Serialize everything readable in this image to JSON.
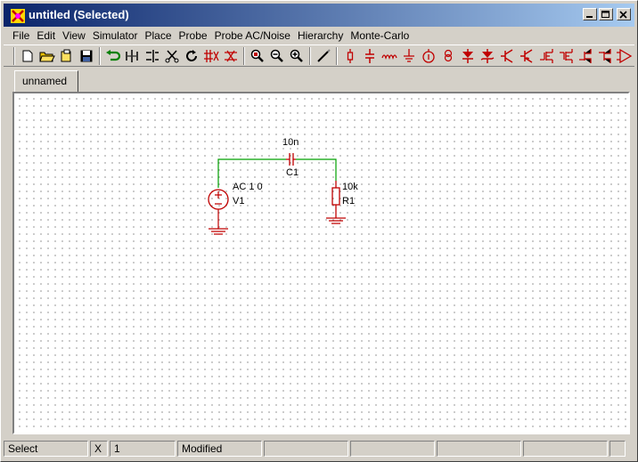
{
  "window": {
    "title": "untitled (Selected)"
  },
  "menu": [
    "File",
    "Edit",
    "View",
    "Simulator",
    "Place",
    "Probe",
    "Probe AC/Noise",
    "Hierarchy",
    "Monte-Carlo"
  ],
  "toolbar": {
    "groups": [
      [
        "new-icon",
        "open-folder-icon",
        "open-file-icon",
        "save-icon"
      ],
      [
        "undo-icon",
        "mirror-horizontal-icon",
        "mirror-vertical-icon",
        "cut-icon",
        "rotate-icon",
        "delete-wire-icon",
        "duplicate-icon"
      ],
      [
        "zoom-fit-icon",
        "zoom-out-icon",
        "zoom-in-icon"
      ],
      [
        "wire-draw-icon"
      ],
      [
        "resistor-icon",
        "capacitor-icon",
        "inductor-icon",
        "ground-icon",
        "voltage-source-icon",
        "current-source-icon",
        "diode-icon",
        "zener-icon",
        "npn-icon",
        "pnp-icon",
        "nmos-icon",
        "pmos-icon",
        "njfet-icon",
        "pjfet-icon",
        "opamp-icon"
      ]
    ]
  },
  "tab": {
    "label": "unnamed"
  },
  "schematic": {
    "capacitor": {
      "value": "10n",
      "ref": "C1"
    },
    "resistor": {
      "value": "10k",
      "ref": "R1"
    },
    "source": {
      "value": "AC 1 0",
      "ref": "V1"
    },
    "colors": {
      "wire": "#00a000",
      "component": "#c00000"
    }
  },
  "status": [
    "Select",
    "X",
    "1",
    "Modified",
    "",
    "",
    "",
    "",
    ""
  ]
}
